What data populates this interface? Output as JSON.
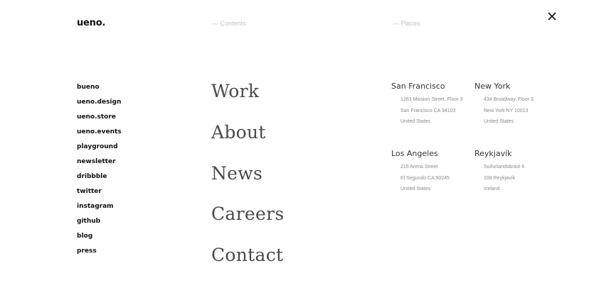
{
  "header": {
    "logo": "ueno.",
    "close_icon": "close-icon"
  },
  "labels": {
    "contents": "— Contents",
    "places": "— Places"
  },
  "side_links": [
    "bueno",
    "ueno.design",
    "ueno.store",
    "ueno.events",
    "playground",
    "newsletter",
    "dribbble",
    "twitter",
    "instagram",
    "github",
    "blog",
    "press"
  ],
  "main_nav": [
    "Work",
    "About",
    "News",
    "Careers",
    "Contact"
  ],
  "places": [
    {
      "city": "San Francisco",
      "lines": [
        "1263 Mission Street, Floor 3",
        "San Francisco CA 94103",
        "United States"
      ]
    },
    {
      "city": "New York",
      "lines": [
        "434 Broadway, Floor 3",
        "New York NY 10013",
        "United States"
      ]
    },
    {
      "city": "Los Angeles",
      "lines": [
        "215 Arena Street",
        "El Segundo CA 90245",
        "United States"
      ]
    },
    {
      "city": "Reykjavík",
      "lines": [
        "Suðurlandsbraut 6",
        "108 Reykjavík",
        "Iceland"
      ]
    }
  ]
}
